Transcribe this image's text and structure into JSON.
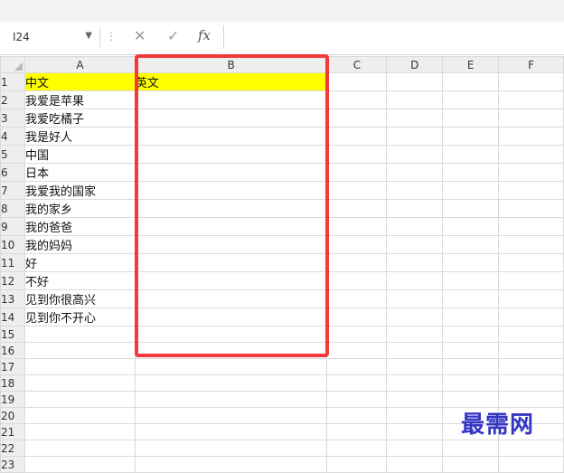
{
  "name_box": {
    "value": "I24"
  },
  "formula_bar": {
    "fx_label": "fx",
    "cancel_glyph": "✕",
    "enter_glyph": "✓",
    "content": ""
  },
  "columns": [
    "A",
    "B",
    "C",
    "D",
    "E",
    "F"
  ],
  "rows": [
    {
      "num": "1",
      "a": "中文",
      "b": "英文"
    },
    {
      "num": "2",
      "a": "我爱是苹果",
      "b": ""
    },
    {
      "num": "3",
      "a": "我爱吃橘子",
      "b": ""
    },
    {
      "num": "4",
      "a": "我是好人",
      "b": ""
    },
    {
      "num": "5",
      "a": "中国",
      "b": ""
    },
    {
      "num": "6",
      "a": "日本",
      "b": ""
    },
    {
      "num": "7",
      "a": "我爱我的国家",
      "b": ""
    },
    {
      "num": "8",
      "a": "我的家乡",
      "b": ""
    },
    {
      "num": "9",
      "a": "我的爸爸",
      "b": ""
    },
    {
      "num": "10",
      "a": "我的妈妈",
      "b": ""
    },
    {
      "num": "11",
      "a": "好",
      "b": ""
    },
    {
      "num": "12",
      "a": "不好",
      "b": ""
    },
    {
      "num": "13",
      "a": "见到你很高兴",
      "b": ""
    },
    {
      "num": "14",
      "a": "见到你不开心",
      "b": ""
    },
    {
      "num": "15",
      "a": "",
      "b": ""
    },
    {
      "num": "16",
      "a": "",
      "b": ""
    },
    {
      "num": "17",
      "a": "",
      "b": ""
    },
    {
      "num": "18",
      "a": "",
      "b": ""
    },
    {
      "num": "19",
      "a": "",
      "b": ""
    },
    {
      "num": "20",
      "a": "",
      "b": ""
    },
    {
      "num": "21",
      "a": "",
      "b": ""
    },
    {
      "num": "22",
      "a": "",
      "b": ""
    },
    {
      "num": "23",
      "a": "",
      "b": ""
    }
  ],
  "highlight_color": "#ffff00",
  "annotation_color": "#f23a3a",
  "watermark": "最需网"
}
